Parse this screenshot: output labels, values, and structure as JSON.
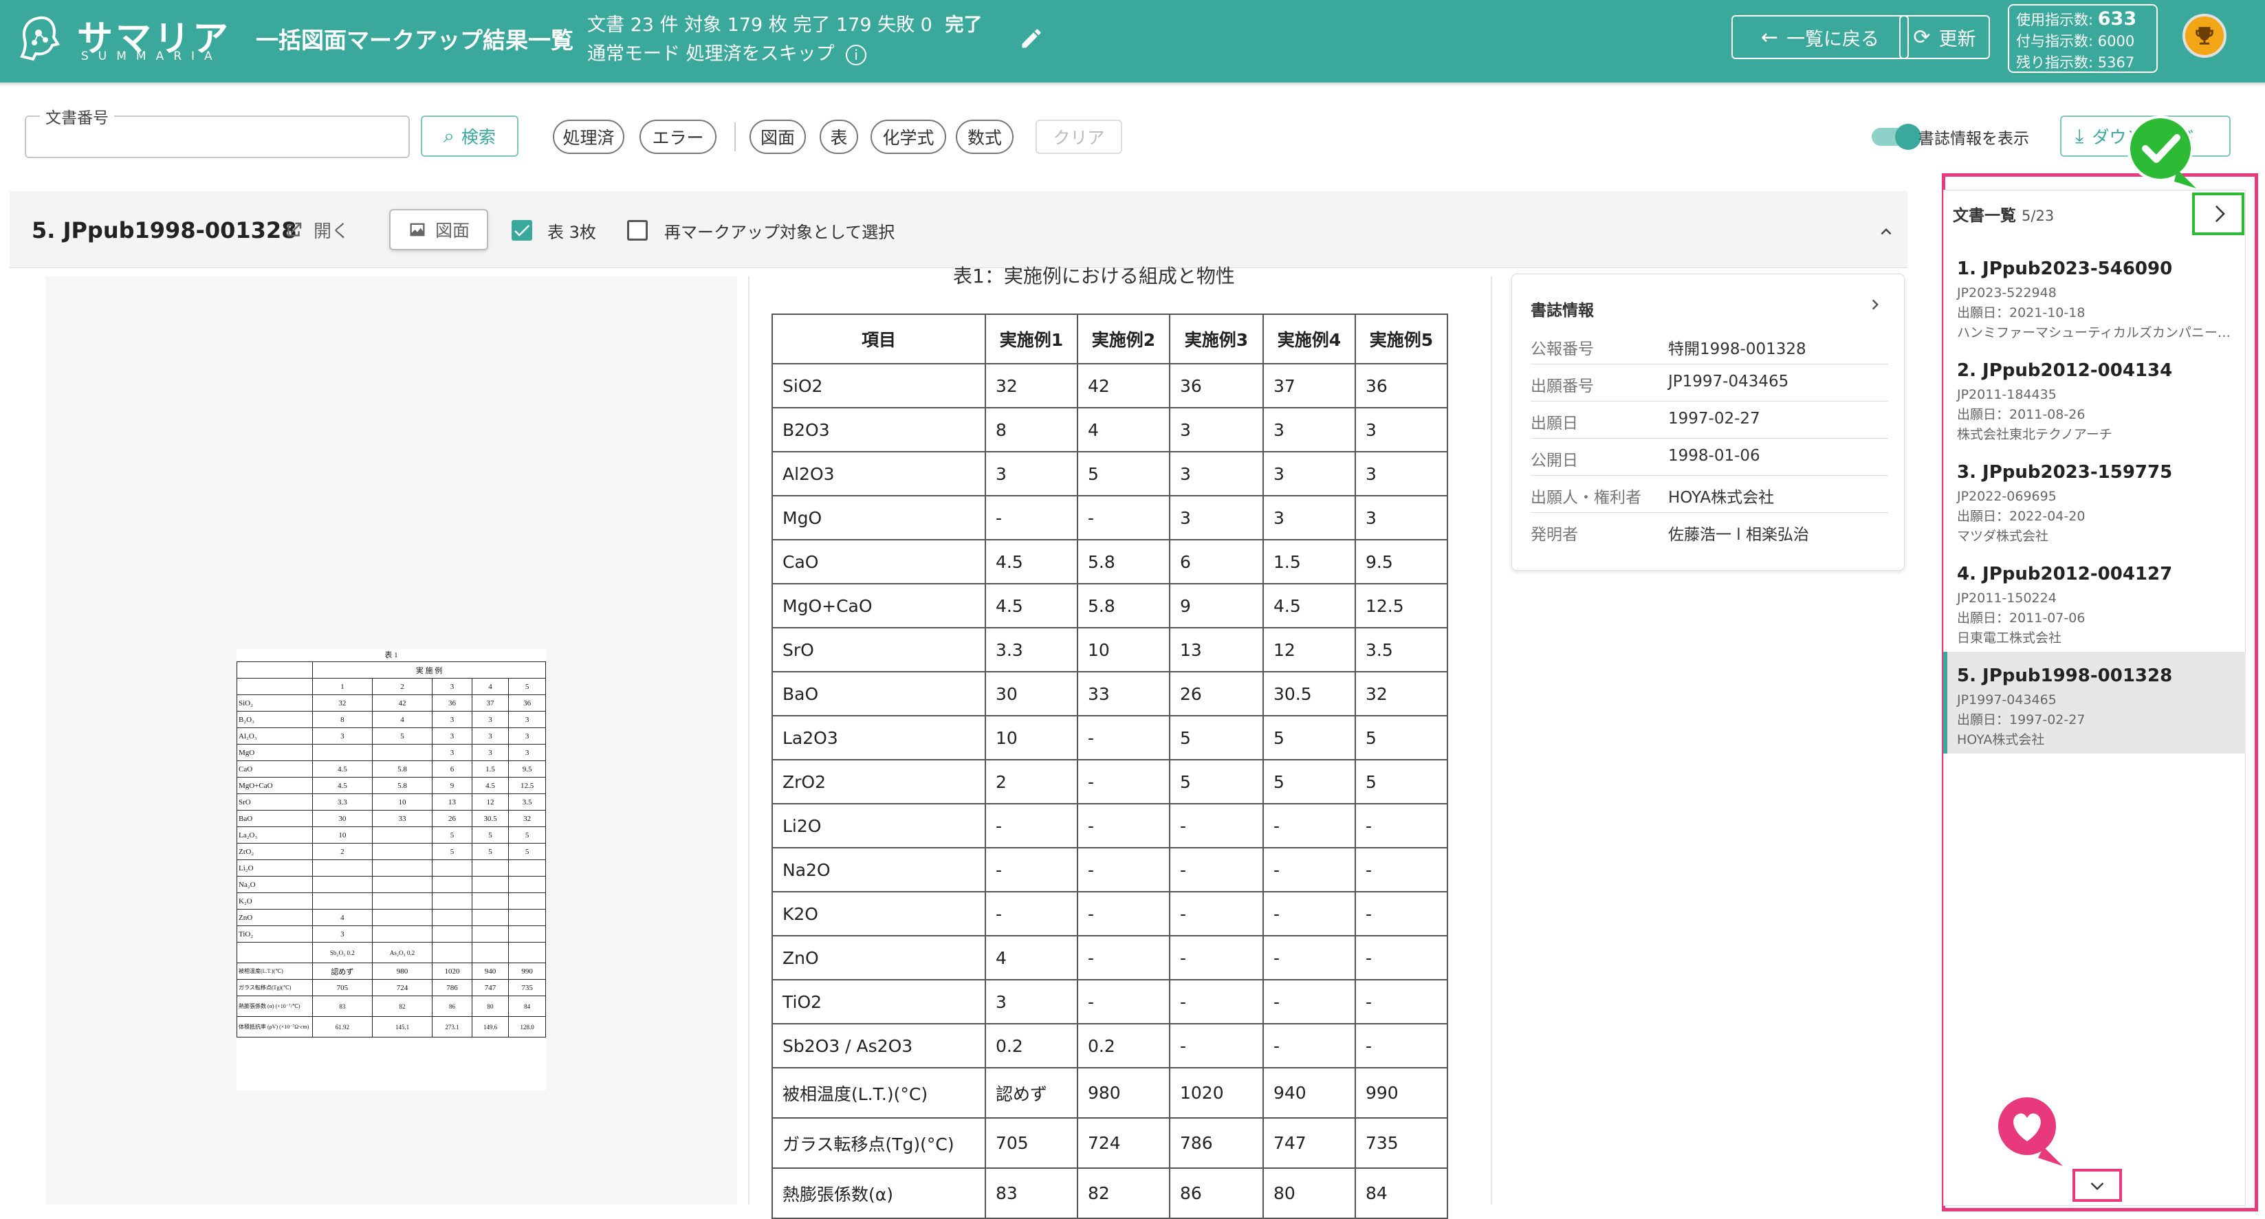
{
  "app": {
    "logo_text": "サマリア",
    "logo_sub": "SUMMARIA",
    "title": "一括図面マークアップ結果一覧"
  },
  "header": {
    "stats": "文書 23 件 対象 179 枚 完了 179 失敗 0",
    "status": "完了",
    "mode": "通常モード 処理済をスキップ",
    "back_label": "一覧に戻る",
    "refresh_label": "更新",
    "usage": {
      "used_label": "使用指示数:",
      "used": "633",
      "granted_label": "付与指示数:",
      "granted": "6000",
      "remaining_label": "残り指示数:",
      "remaining": "5367"
    }
  },
  "filters": {
    "doc_number_label": "文書番号",
    "doc_number_value": "",
    "search_label": "検索",
    "status_chips": [
      "処理済",
      "エラー"
    ],
    "type_chips": [
      "図面",
      "表",
      "化学式",
      "数式"
    ],
    "clear_label": "クリア",
    "biblio_toggle_label": "書誌情報を表示",
    "download_label": "ダウンロード"
  },
  "document": {
    "title": "5. JPpub1998-001328",
    "open_label": "開く",
    "figure_label": "図面",
    "table_label": "表 3枚",
    "remarkup_label": "再マークアップ対象として選択"
  },
  "table": {
    "caption": "表1：実施例における組成と物性",
    "headers": [
      "項目",
      "実施例1",
      "実施例2",
      "実施例3",
      "実施例4",
      "実施例5"
    ],
    "rows": [
      [
        "SiO2",
        "32",
        "42",
        "36",
        "37",
        "36"
      ],
      [
        "B2O3",
        "8",
        "4",
        "3",
        "3",
        "3"
      ],
      [
        "Al2O3",
        "3",
        "5",
        "3",
        "3",
        "3"
      ],
      [
        "MgO",
        "-",
        "-",
        "3",
        "3",
        "3"
      ],
      [
        "CaO",
        "4.5",
        "5.8",
        "6",
        "1.5",
        "9.5"
      ],
      [
        "MgO+CaO",
        "4.5",
        "5.8",
        "9",
        "4.5",
        "12.5"
      ],
      [
        "SrO",
        "3.3",
        "10",
        "13",
        "12",
        "3.5"
      ],
      [
        "BaO",
        "30",
        "33",
        "26",
        "30.5",
        "32"
      ],
      [
        "La2O3",
        "10",
        "-",
        "5",
        "5",
        "5"
      ],
      [
        "ZrO2",
        "2",
        "-",
        "5",
        "5",
        "5"
      ],
      [
        "Li2O",
        "-",
        "-",
        "-",
        "-",
        "-"
      ],
      [
        "Na2O",
        "-",
        "-",
        "-",
        "-",
        "-"
      ],
      [
        "K2O",
        "-",
        "-",
        "-",
        "-",
        "-"
      ],
      [
        "ZnO",
        "4",
        "-",
        "-",
        "-",
        "-"
      ],
      [
        "TiO2",
        "3",
        "-",
        "-",
        "-",
        "-"
      ],
      [
        "Sb2O3 / As2O3",
        "0.2",
        "0.2",
        "-",
        "-",
        "-"
      ],
      [
        "被相温度(L.T.)(°C)",
        "認めず",
        "980",
        "1020",
        "940",
        "990"
      ],
      [
        "ガラス転移点(Tg)(°C)",
        "705",
        "724",
        "786",
        "747",
        "735"
      ],
      [
        "熱膨張係数(α)",
        "83",
        "82",
        "86",
        "80",
        "84"
      ]
    ]
  },
  "scan": {
    "title": "表 1",
    "group_header": "実 施 例",
    "col_numbers": [
      "1",
      "2",
      "3",
      "4",
      "5"
    ],
    "rows": [
      [
        "SiO₂",
        "32",
        "42",
        "36",
        "37",
        "36"
      ],
      [
        "B₂O₃",
        "8",
        "4",
        "3",
        "3",
        "3"
      ],
      [
        "Al₂O₃",
        "3",
        "5",
        "3",
        "3",
        "3"
      ],
      [
        "MgO",
        "",
        "",
        "3",
        "3",
        "3"
      ],
      [
        "CaO",
        "4.5",
        "5.8",
        "6",
        "1.5",
        "9.5"
      ],
      [
        "MgO+CaO",
        "4.5",
        "5.8",
        "9",
        "4.5",
        "12.5"
      ],
      [
        "SrO",
        "3.3",
        "10",
        "13",
        "12",
        "3.5"
      ],
      [
        "BaO",
        "30",
        "33",
        "26",
        "30.5",
        "32"
      ],
      [
        "La₂O₃",
        "10",
        "",
        "5",
        "5",
        "5"
      ],
      [
        "ZrO₂",
        "2",
        "",
        "5",
        "5",
        "5"
      ],
      [
        "Li₂O",
        "",
        "",
        "",
        "",
        ""
      ],
      [
        "Na₂O",
        "",
        "",
        "",
        "",
        ""
      ],
      [
        "K₂O",
        "",
        "",
        "",
        "",
        ""
      ],
      [
        "ZnO",
        "4",
        "",
        "",
        "",
        ""
      ],
      [
        "TiO₂",
        "3",
        "",
        "",
        "",
        ""
      ],
      [
        "",
        "Sb₂O₃ 0.2",
        "As₂O₃ 0.2",
        "",
        "",
        ""
      ],
      [
        "被相温度(L.T.)(℃)",
        "認めず",
        "980",
        "1020",
        "940",
        "990"
      ],
      [
        "ガラス転移点(Tg)(℃)",
        "705",
        "724",
        "786",
        "747",
        "735"
      ],
      [
        "熱膨張係数 (α) (×10⁻⁷/℃)",
        "83",
        "82",
        "86",
        "80",
        "84"
      ],
      [
        "体積抵抗率 (ρV) (×10⁻⁷Ω·cm)",
        "61.92",
        "145.1",
        "273.1",
        "149.6",
        "128.0"
      ]
    ]
  },
  "biblio": {
    "title": "書誌情報",
    "rows": [
      {
        "k": "公報番号",
        "v": "特開1998-001328"
      },
      {
        "k": "出願番号",
        "v": "JP1997-043465"
      },
      {
        "k": "出願日",
        "v": "1997-02-27"
      },
      {
        "k": "公開日",
        "v": "1998-01-06"
      },
      {
        "k": "出願人・権利者",
        "v": "HOYA株式会社"
      },
      {
        "k": "発明者",
        "v": "佐藤浩一 l 相楽弘治"
      }
    ]
  },
  "doc_list": {
    "title": "文書一覧",
    "position": "5/23",
    "items": [
      {
        "title": "1. JPpub2023-546090",
        "app_no": "JP2023-522948",
        "date": "出願日：2021-10-18",
        "owner": "ハンミファーマシューティカルズカンパニーリミテッド"
      },
      {
        "title": "2. JPpub2012-004134",
        "app_no": "JP2011-184435",
        "date": "出願日：2011-08-26",
        "owner": "株式会社東北テクノアーチ"
      },
      {
        "title": "3. JPpub2023-159775",
        "app_no": "JP2022-069695",
        "date": "出願日：2022-04-20",
        "owner": "マツダ株式会社"
      },
      {
        "title": "4. JPpub2012-004127",
        "app_no": "JP2011-150224",
        "date": "出願日：2011-07-06",
        "owner": "日東電工株式会社"
      },
      {
        "title": "5. JPpub1998-001328",
        "app_no": "JP1997-043465",
        "date": "出願日：1997-02-27",
        "owner": "HOYA株式会社"
      }
    ]
  },
  "colors": {
    "accent": "#3aa89b",
    "highlight_pink": "#e8397d",
    "highlight_green": "#2dbb35",
    "trophy": "#f2a515"
  }
}
